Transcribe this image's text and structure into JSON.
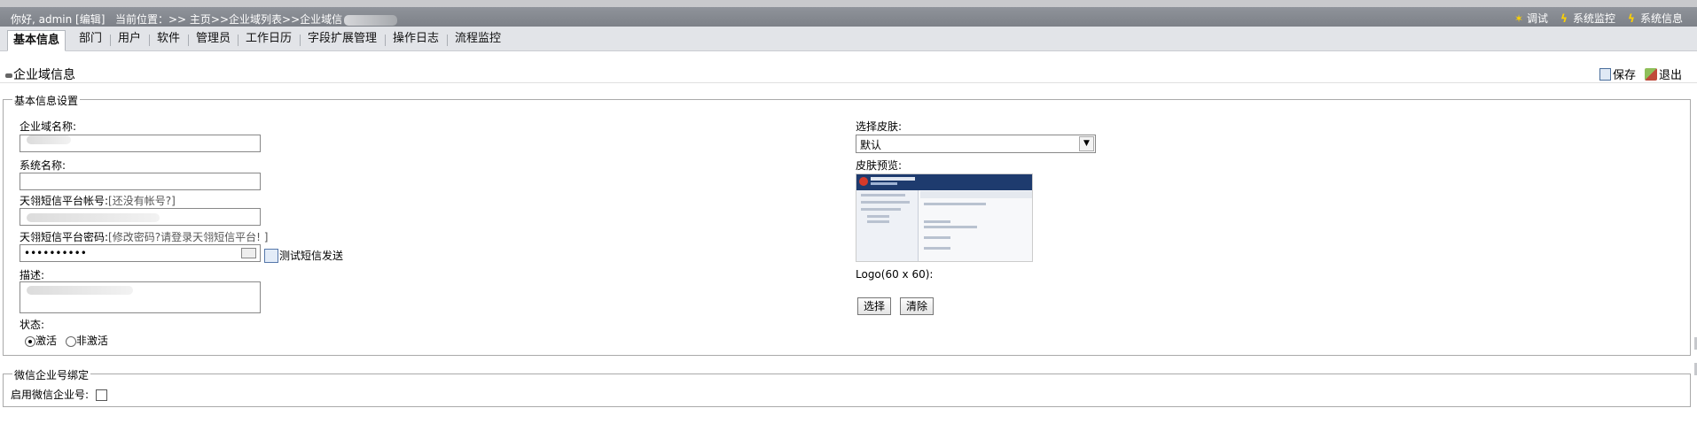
{
  "topbar": {
    "greeting": "你好, admin [编辑]",
    "breadcrumb": "当前位置：>> 主页>>企业域列表>>企业域信",
    "links": [
      {
        "label": "调试",
        "icon": "debug-icon"
      },
      {
        "label": "系统监控",
        "icon": "lightning-icon"
      },
      {
        "label": "系统信息",
        "icon": "lightning-icon"
      }
    ]
  },
  "tabs": [
    {
      "label": "基本信息",
      "active": true
    },
    {
      "label": "部门"
    },
    {
      "label": "用户"
    },
    {
      "label": "软件"
    },
    {
      "label": "管理员"
    },
    {
      "label": "工作日历"
    },
    {
      "label": "字段扩展管理"
    },
    {
      "label": "操作日志"
    },
    {
      "label": "流程监控"
    }
  ],
  "page": {
    "title": "企业域信息",
    "save_label": "保存",
    "exit_label": "退出"
  },
  "basic": {
    "legend": "基本信息设置",
    "domain_name_label": "企业域名称:",
    "domain_name_value": "",
    "system_name_label": "系统名称:",
    "system_name_value": "",
    "sms_account_label": "天翎短信平台帐号:",
    "sms_account_hint": "[还没有帐号?]",
    "sms_account_value": "",
    "sms_password_label": "天翎短信平台密码:",
    "sms_password_hint": "[修改密码?请登录天翎短信平台! ]",
    "sms_password_value": "••••••••••",
    "test_sms_label": "测试短信发送",
    "description_label": "描述:",
    "status_label": "状态:",
    "status_active": "激活",
    "status_inactive": "非激活",
    "skin_label": "选择皮肤:",
    "skin_value": "默认",
    "skin_preview_label": "皮肤预览:",
    "logo_label": "Logo(60 x 60):",
    "select_button": "选择",
    "clear_button": "清除"
  },
  "wechat": {
    "legend": "微信企业号绑定",
    "enable_label": "启用微信企业号:"
  },
  "colors": {
    "topbar": "#858990",
    "tabs_bg": "#e2e4e8"
  }
}
